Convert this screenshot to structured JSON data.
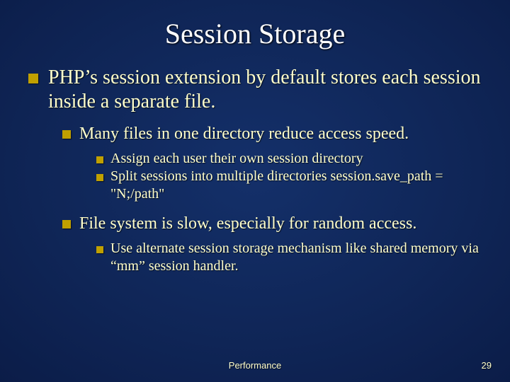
{
  "title": "Session Storage",
  "bullet_l1": "PHP’s session extension by default stores each session inside a separate file.",
  "sub1": {
    "heading": "Many files in one directory reduce access speed.",
    "items": [
      "Assign each user their own session directory",
      "Split sessions into multiple directories session.save_path = \"N;/path\""
    ]
  },
  "sub2": {
    "heading": "File system is slow, especially for random access.",
    "items": [
      "Use alternate session storage mechanism like shared memory via “mm” session handler."
    ]
  },
  "footer": {
    "center": "Performance",
    "page": "29"
  }
}
